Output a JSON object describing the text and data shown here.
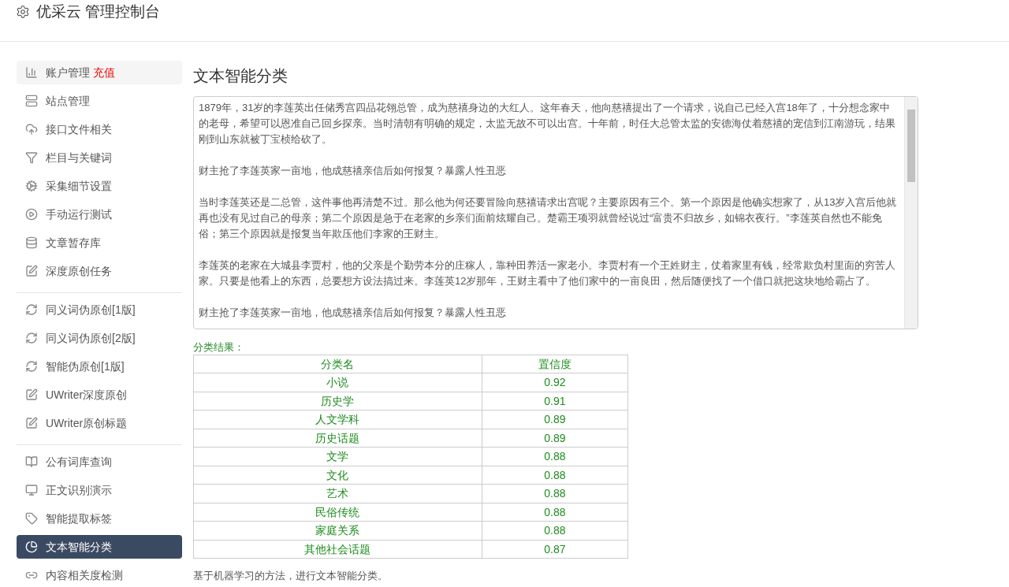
{
  "header": {
    "title": "优采云 管理控制台"
  },
  "sidebar": {
    "groups": [
      [
        {
          "label": "账户管理",
          "badge": "充值",
          "selected": false
        },
        {
          "label": "站点管理",
          "selected": false
        },
        {
          "label": "接口文件相关",
          "selected": false
        },
        {
          "label": "栏目与关键词",
          "selected": false
        },
        {
          "label": "采集细节设置",
          "selected": false
        },
        {
          "label": "手动运行测试",
          "selected": false
        },
        {
          "label": "文章暂存库",
          "selected": false
        },
        {
          "label": "深度原创任务",
          "selected": false
        }
      ],
      [
        {
          "label": "同义词伪原创[1版]",
          "selected": false
        },
        {
          "label": "同义词伪原创[2版]",
          "selected": false
        },
        {
          "label": "智能伪原创[1版]",
          "selected": false
        },
        {
          "label": "UWriter深度原创",
          "selected": false
        },
        {
          "label": "UWriter原创标题",
          "selected": false
        }
      ],
      [
        {
          "label": "公有词库查询",
          "selected": false
        },
        {
          "label": "正文识别演示",
          "selected": false
        },
        {
          "label": "智能提取标签",
          "selected": false
        },
        {
          "label": "文本智能分类",
          "selected": true
        },
        {
          "label": "内容相关度检测",
          "selected": false
        }
      ]
    ]
  },
  "content": {
    "title": "文本智能分类",
    "text_area": {
      "paragraphs": [
        "1879年，31岁的李莲英出任储秀宫四品花翎总管，成为慈禧身边的大红人。这年春天，他向慈禧提出了一个请求，说自己已经入宫18年了，十分想念家中的老母，希望可以恩准自己回乡探亲。当时清朝有明确的规定，太监无故不可以出宫。十年前，时任大总管太监的安德海仗着慈禧的宠信到江南游玩，结果刚到山东就被丁宝桢给砍了。",
        "财主抢了李莲英家一亩地，他成慈禧亲信后如何报复？暴露人性丑恶",
        "当时李莲英还是二总管，这件事他再清楚不过。那么他为何还要冒险向慈禧请求出宫呢？主要原因有三个。第一个原因是他确实想家了，从13岁入宫后他就再也没有见过自己的母亲；第二个原因是急于在老家的乡亲们面前炫耀自己。楚霸王项羽就曾经说过“富贵不归故乡，如锦衣夜行。”李莲英自然也不能免俗；第三个原因就是报复当年欺压他们李家的王财主。",
        "李莲英的老家在大城县李贾村，他的父亲是个勤劳本分的庄稼人，靠种田养活一家老小。李贾村有一个王姓财主，仗着家里有钱，经常欺负村里面的穷苦人家。只要是他看上的东西，总要想方设法搞过来。李莲英12岁那年，王财主看中了他们家中的一亩良田，然后随便找了一个借口就把这块地给霸占了。",
        "财主抢了李莲英家一亩地，他成慈禧亲信后如何报复？暴露人性丑恶"
      ]
    },
    "result_label": "分类结果：",
    "table": {
      "columns": [
        "分类名",
        "置信度"
      ],
      "rows": [
        [
          "小说",
          "0.92"
        ],
        [
          "历史学",
          "0.91"
        ],
        [
          "人文学科",
          "0.89"
        ],
        [
          "历史话题",
          "0.89"
        ],
        [
          "文学",
          "0.88"
        ],
        [
          "文化",
          "0.88"
        ],
        [
          "艺术",
          "0.88"
        ],
        [
          "民俗传统",
          "0.88"
        ],
        [
          "家庭关系",
          "0.88"
        ],
        [
          "其他社会话题",
          "0.87"
        ]
      ]
    },
    "note": "基于机器学习的方法，进行文本智能分类。"
  }
}
